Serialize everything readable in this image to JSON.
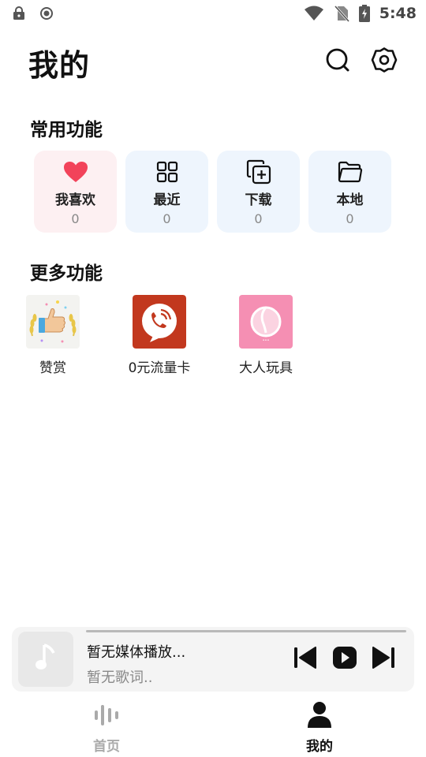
{
  "status_bar": {
    "time": "5:48",
    "icons": [
      "lock-icon",
      "record-icon",
      "wifi-icon",
      "no-sim-icon",
      "battery-charging-icon"
    ]
  },
  "header": {
    "title": "我的",
    "search_icon": "search-icon",
    "settings_icon": "settings-icon"
  },
  "common_section": {
    "title": "常用功能",
    "items": [
      {
        "label": "我喜欢",
        "count": "0",
        "icon": "heart-icon",
        "bg": "#fdf0f2",
        "accent": "#f2435a"
      },
      {
        "label": "最近",
        "count": "0",
        "icon": "grid-icon",
        "bg": "#eef5fd"
      },
      {
        "label": "下载",
        "count": "0",
        "icon": "copy-plus-icon",
        "bg": "#eef5fd"
      },
      {
        "label": "本地",
        "count": "0",
        "icon": "folder-icon",
        "bg": "#eef5fd"
      }
    ]
  },
  "more_section": {
    "title": "更多功能",
    "apps": [
      {
        "label": "赞赏",
        "icon": "thumbs-up-laurel-icon"
      },
      {
        "label": "0元流量卡",
        "icon": "phone-call-icon",
        "color": "#c2381e"
      },
      {
        "label": "大人玩具",
        "icon": "peach-icon",
        "color": "#f58fb3"
      }
    ]
  },
  "player": {
    "title": "暂无媒体播放...",
    "lyrics": "暂无歌词..",
    "art_icon": "music-note-icon"
  },
  "bottom_nav": {
    "items": [
      {
        "label": "首页",
        "icon": "equalizer-icon",
        "active": false
      },
      {
        "label": "我的",
        "icon": "person-icon",
        "active": true
      }
    ]
  }
}
